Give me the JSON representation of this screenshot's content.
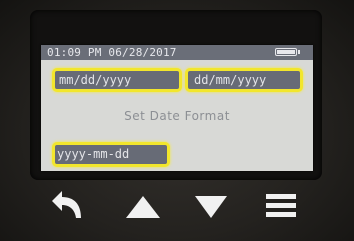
{
  "status_bar": {
    "datetime": "01:09 PM 06/28/2017",
    "battery_icon": "battery-full-icon"
  },
  "options": [
    {
      "label": "mm/dd/yyyy"
    },
    {
      "label": "dd/mm/yyyy"
    },
    {
      "label": "yyyy-mm-dd"
    }
  ],
  "prompt": "Set Date Format",
  "buttons": [
    {
      "icon": "back-arrow-icon"
    },
    {
      "icon": "up-triangle-icon"
    },
    {
      "icon": "down-triangle-icon"
    },
    {
      "icon": "menu-icon"
    }
  ],
  "colors": {
    "highlight": "#f2e62c",
    "option_bg": "#676b76",
    "screen_bg": "#d8d9d6",
    "button_fg": "#f1f1f1"
  }
}
